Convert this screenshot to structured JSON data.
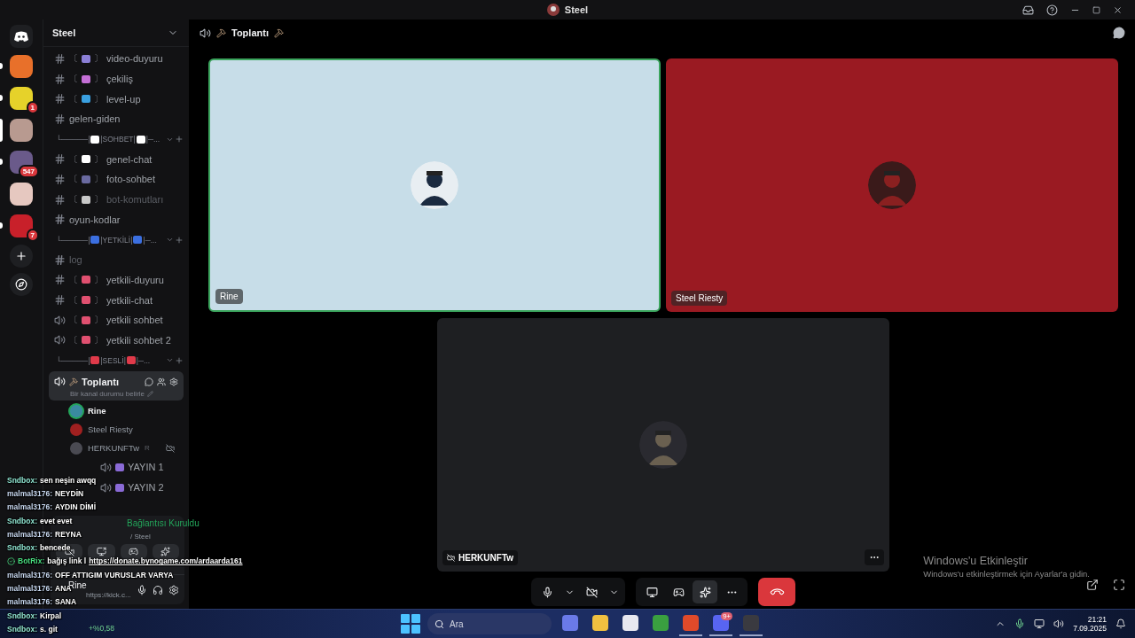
{
  "window": {
    "title": "Steel"
  },
  "servers": [
    {
      "color": "#e8702a",
      "unread": true,
      "selected": false
    },
    {
      "color": "#e6d22a",
      "unread": true,
      "selected": false,
      "badge": "1"
    },
    {
      "color": "#b89a90",
      "unread": false,
      "selected": true
    },
    {
      "color": "#6a5a8a",
      "unread": true,
      "selected": false,
      "badge": "547"
    },
    {
      "color": "#e6c8c0",
      "unread": false,
      "selected": false
    },
    {
      "color": "#c8202a",
      "unread": true,
      "selected": false,
      "badge": "7"
    }
  ],
  "sidebar": {
    "title": "Steel",
    "items": [
      {
        "kind": "text_channel",
        "prefix": "〔",
        "suffix": "〕",
        "color": "#8b7fd6",
        "name": "video-duyuru",
        "muted": false
      },
      {
        "kind": "text_channel",
        "prefix": "〔",
        "suffix": "〕",
        "color": "#c46fd6",
        "name": "çekiliş",
        "muted": false
      },
      {
        "kind": "text_channel",
        "prefix": "〔",
        "suffix": "〕",
        "color": "#3aa0e0",
        "name": "level-up",
        "muted": false
      },
      {
        "kind": "text_channel",
        "name": "gelen-giden",
        "muted": false
      },
      {
        "kind": "category",
        "lead": "└─────|",
        "name": "|SOHBET|",
        "tail": "|─...",
        "color": "#ffffff"
      },
      {
        "kind": "text_channel",
        "prefix": "〔",
        "suffix": "〕",
        "color": "#ffffff",
        "name": "genel-chat",
        "muted": false
      },
      {
        "kind": "text_channel",
        "prefix": "〔",
        "suffix": "〕",
        "color": "#6a6aa0",
        "name": "foto-sohbet",
        "muted": false
      },
      {
        "kind": "text_channel",
        "prefix": "〔",
        "suffix": "〕",
        "color": "#c8c8c8",
        "name": "bot-komutları",
        "muted": true
      },
      {
        "kind": "thread_channel",
        "name": "oyun-kodlar",
        "muted": false
      },
      {
        "kind": "category",
        "lead": "└─────|",
        "name": "|YETKİLİ|",
        "tail": "|─...",
        "color": "#3b6fe0"
      },
      {
        "kind": "thread_channel",
        "name": "log",
        "muted": true
      },
      {
        "kind": "text_channel",
        "prefix": "〔",
        "suffix": "〕",
        "color": "#e05070",
        "name": "yetkili-duyuru",
        "muted": false
      },
      {
        "kind": "text_channel",
        "prefix": "〔",
        "suffix": "〕",
        "color": "#e05070",
        "name": "yetkili-chat",
        "muted": false
      },
      {
        "kind": "voice_channel",
        "prefix": "〔",
        "suffix": "〕",
        "color": "#e05070",
        "name": "yetkili sohbet",
        "muted": false
      },
      {
        "kind": "voice_channel",
        "prefix": "〔",
        "suffix": "〕",
        "color": "#e05070",
        "name": "yetkili sohbet 2",
        "muted": false
      },
      {
        "kind": "category",
        "lead": "└─────|",
        "name": "|SESLİ|",
        "tail": "|─...",
        "color": "#e03a4a"
      },
      {
        "kind": "voice_active",
        "name": "Toplantı",
        "status": "Bir kanal durumu belirle",
        "selected": true,
        "children": [
          {
            "name": "Rine",
            "speaking": true,
            "color": "#3a8aa0"
          },
          {
            "name": "Steel Riesty",
            "speaking": false,
            "color": "#a02020"
          },
          {
            "name": "HERKUNFTw",
            "speaking": false,
            "color": "#4a4a52",
            "tag": "R",
            "muted": true
          }
        ]
      },
      {
        "kind": "stream_channel",
        "color": "#8a6ad6",
        "name": "YAYIN 1",
        "muted": false
      },
      {
        "kind": "stream_channel",
        "color": "#8a6ad6",
        "name": "YAYIN 2",
        "muted": false
      }
    ]
  },
  "voice_panel": {
    "status": "Bağlantısı Kuruldu",
    "channel": "/ Steel"
  },
  "user_panel": {
    "name": "Rine",
    "status": "https://kick.c..."
  },
  "call": {
    "title": "Toplantı",
    "tiles": [
      {
        "name": "Rine",
        "speaking": true,
        "color": "#c7dde8",
        "muted": false
      },
      {
        "name": "Steel Riesty",
        "speaking": false,
        "color": "#9a1a22",
        "muted": false
      },
      {
        "name": "HERKUNFTw",
        "speaking": false,
        "color": "#1e1f22",
        "muted": true
      }
    ],
    "controls": [
      {
        "kind": "mic",
        "selected": false
      },
      {
        "kind": "chevron",
        "selected": false
      },
      {
        "kind": "camera_off",
        "selected": false
      },
      {
        "kind": "chevron",
        "selected": false
      }
    ],
    "actions": [
      {
        "kind": "screen",
        "selected": false
      },
      {
        "kind": "game",
        "selected": false
      },
      {
        "kind": "activity",
        "selected": true
      },
      {
        "kind": "more",
        "selected": false
      }
    ]
  },
  "activation": {
    "title": "Windows'u Etkinleştir",
    "text": "Windows'u etkinleştirmek için Ayarlar'a gidin."
  },
  "taskbar": {
    "search_placeholder": "Ara",
    "widget_change": "+%0,58",
    "apps": [
      {
        "kind": "copilot",
        "running": false
      },
      {
        "kind": "files",
        "running": false
      },
      {
        "kind": "store",
        "running": false
      },
      {
        "kind": "minecraft",
        "running": false
      },
      {
        "kind": "brave",
        "running": true
      },
      {
        "kind": "discord",
        "running": true,
        "badge": "9+"
      },
      {
        "kind": "obs",
        "running": true
      }
    ],
    "time": "21:21",
    "date": "7.09.2025"
  },
  "overlay_chat": [
    {
      "author": "Sndbox:",
      "color": "#8fe3d0",
      "text": "sen neşin awqq"
    },
    {
      "author": "malmal3176:",
      "color": "#c8d8f0",
      "text": "NEYDİN"
    },
    {
      "author": "malmal3176:",
      "color": "#c8d8f0",
      "text": "AYDIN DİMİ"
    },
    {
      "author": "Sndbox:",
      "color": "#8fe3d0",
      "text": "evet evet"
    },
    {
      "author": "malmal3176:",
      "color": "#c8d8f0",
      "text": "REYNA"
    },
    {
      "author": "Sndbox:",
      "color": "#8fe3d0",
      "text": "bencede"
    },
    {
      "author": "BotRix:",
      "color": "#4ade80",
      "text": "bağış link l",
      "link": "https://donate.bynogame.com/ardaarda161",
      "bot": true
    },
    {
      "author": "malmal3176:",
      "color": "#c8d8f0",
      "text": "OFF ATTIGIM VURUSLAR VARYA"
    },
    {
      "author": "malmal3176:",
      "color": "#c8d8f0",
      "text": "ANA"
    },
    {
      "author": "malmal3176:",
      "color": "#c8d8f0",
      "text": "SANA"
    },
    {
      "author": "Sndbox:",
      "color": "#8fe3d0",
      "text": "Kirpal"
    },
    {
      "author": "Sndbox:",
      "color": "#8fe3d0",
      "text": "s. git"
    }
  ]
}
